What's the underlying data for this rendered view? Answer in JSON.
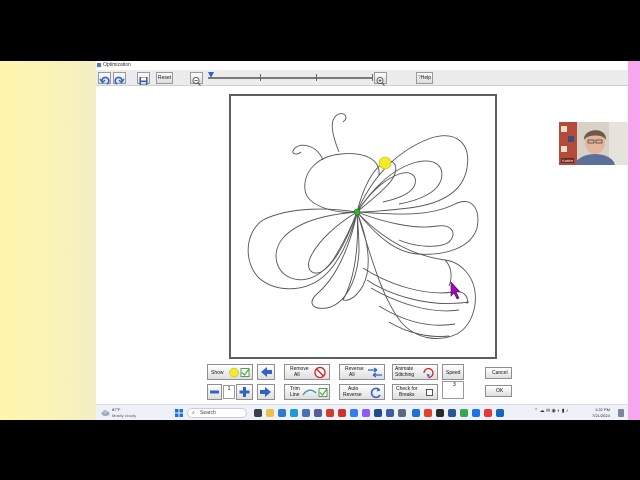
{
  "window": {
    "title": "Optimization"
  },
  "toolbar": {
    "reset_label": "Reset",
    "help_label": "Help"
  },
  "bottom_panel": {
    "show_label": "Show",
    "remove_all_line1": "Remove",
    "remove_all_line2": "All",
    "reverse_all_line1": "Reverse",
    "reverse_all_line2": "All",
    "animate_line1": "Animate",
    "animate_line2": "Stitching",
    "speed_label": "Speed",
    "cancel_label": "Cancel",
    "stepper_value": "1",
    "trim_line1": "Trim",
    "trim_line2": "Line",
    "auto_reverse_line1": "Auto",
    "auto_reverse_line2": "Reverse",
    "check_breaks_line1": "Check for",
    "check_breaks_line2": "Breaks",
    "breaks_value": "3",
    "ok_label": "OK"
  },
  "taskbar": {
    "weather_temp": "87°F",
    "weather_desc": "Mostly cloudy",
    "search_placeholder": "Search",
    "time": "1:22 PM",
    "date": "7/21/2024"
  },
  "webcam": {
    "name": "Kathie"
  },
  "colors": {
    "accent": "#2f63c7",
    "start_marker": "#f3ea2a",
    "end_marker": "#2fb52a",
    "cursor": "#b000c8"
  }
}
